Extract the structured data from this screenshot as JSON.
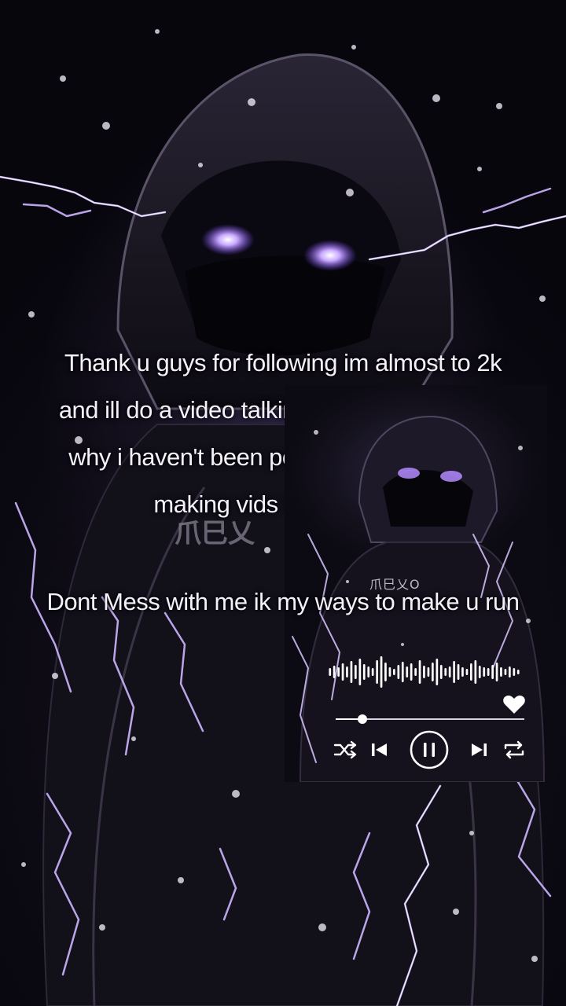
{
  "caption": {
    "lines": [
      "Thank u guys for following im almost to 2k",
      "and ill do a video talking about the vids and",
      "why i haven't been posting but im back to",
      "making vids for you guys",
      "Dont Mess with me ik my ways to make u run"
    ],
    "text_color": "#f4f1fb"
  },
  "background": {
    "accent_color": "#9b6cff",
    "lightning_color": "#cdb6ff",
    "hoodie_logo": "爪巳乂O",
    "player_hoodie_logo": "爪巳乂O"
  },
  "player": {
    "progress": 0.14,
    "icons": {
      "like": "heart-icon",
      "shuffle": "shuffle-icon",
      "previous": "skip-previous-icon",
      "play_pause": "pause-icon",
      "next": "skip-next-icon",
      "repeat": "repeat-icon"
    }
  }
}
